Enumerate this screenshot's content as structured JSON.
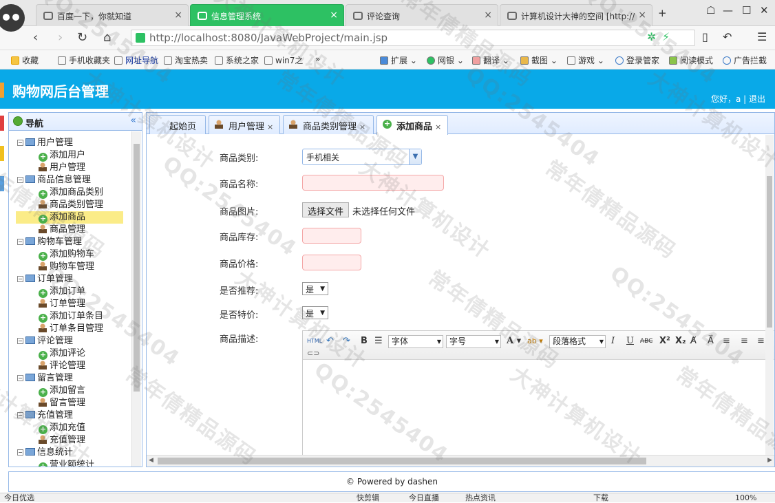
{
  "browser": {
    "tabs": [
      {
        "title": "百度一下，你就知道",
        "active": false
      },
      {
        "title": "信息管理系统",
        "active": true
      },
      {
        "title": "评论查询",
        "active": false
      },
      {
        "title": "计算机设计大神的空间 [http://",
        "active": false
      }
    ],
    "url": "http://localhost:8080/JavaWebProject/main.jsp",
    "bookmarks": [
      "收藏",
      "手机收藏夹",
      "网址导航",
      "淘宝热卖",
      "系统之家",
      "win7之",
      "»"
    ],
    "toolbar_items": [
      "扩展",
      "网银",
      "翻译",
      "截图",
      "游戏",
      "登录管家",
      "阅读模式",
      "广告拦截"
    ],
    "close_symbol": "×"
  },
  "app": {
    "title": "购物网后台管理",
    "greeting": "您好，a | 退出"
  },
  "nav": {
    "header": "导航",
    "collapse_symbol": "«",
    "tree": [
      {
        "label": "用户管理",
        "level": 0
      },
      {
        "label": "添加用户",
        "level": 1,
        "icon": "add"
      },
      {
        "label": "用户管理",
        "level": 1,
        "icon": "user"
      },
      {
        "label": "商品信息管理",
        "level": 0
      },
      {
        "label": "添加商品类别",
        "level": 1,
        "icon": "add"
      },
      {
        "label": "商品类别管理",
        "level": 1,
        "icon": "user"
      },
      {
        "label": "添加商品",
        "level": 1,
        "icon": "add",
        "selected": true
      },
      {
        "label": "商品管理",
        "level": 1,
        "icon": "user"
      },
      {
        "label": "购物车管理",
        "level": 0
      },
      {
        "label": "添加购物车",
        "level": 1,
        "icon": "add"
      },
      {
        "label": "购物车管理",
        "level": 1,
        "icon": "user"
      },
      {
        "label": "订单管理",
        "level": 0
      },
      {
        "label": "添加订单",
        "level": 1,
        "icon": "add"
      },
      {
        "label": "订单管理",
        "level": 1,
        "icon": "user"
      },
      {
        "label": "添加订单条目",
        "level": 1,
        "icon": "add"
      },
      {
        "label": "订单条目管理",
        "level": 1,
        "icon": "user"
      },
      {
        "label": "评论管理",
        "level": 0
      },
      {
        "label": "添加评论",
        "level": 1,
        "icon": "add"
      },
      {
        "label": "评论管理",
        "level": 1,
        "icon": "user"
      },
      {
        "label": "留言管理",
        "level": 0
      },
      {
        "label": "添加留言",
        "level": 1,
        "icon": "add"
      },
      {
        "label": "留言管理",
        "level": 1,
        "icon": "user"
      },
      {
        "label": "充值管理",
        "level": 0
      },
      {
        "label": "添加充值",
        "level": 1,
        "icon": "add"
      },
      {
        "label": "充值管理",
        "level": 1,
        "icon": "user"
      },
      {
        "label": "信息统计",
        "level": 0
      },
      {
        "label": "营业额统计",
        "level": 1,
        "icon": "add"
      }
    ]
  },
  "content_tabs": [
    {
      "label": "起始页",
      "closable": false
    },
    {
      "label": "用户管理",
      "closable": true
    },
    {
      "label": "商品类别管理",
      "closable": true
    },
    {
      "label": "添加商品",
      "closable": true,
      "active": true
    }
  ],
  "form": {
    "category_label": "商品类别:",
    "category_value": "手机相关",
    "name_label": "商品名称:",
    "image_label": "商品图片:",
    "file_button": "选择文件",
    "file_status": "未选择任何文件",
    "stock_label": "商品库存:",
    "price_label": "商品价格:",
    "recommend_label": "是否推荐:",
    "recommend_value": "是",
    "special_label": "是否特价:",
    "special_value": "是",
    "desc_label": "商品描述:"
  },
  "editor_toolbar": {
    "html": "HTML",
    "bold": "B",
    "font_family": "字体",
    "font_size": "字号",
    "paragraph": "段落格式",
    "italic": "I",
    "underline": "U",
    "strike": "ABC",
    "superscript": "X²",
    "subscript": "X₂"
  },
  "footer": "© Powered by dashen",
  "statusbar": {
    "left": "今日优选",
    "items": [
      "快剪辑",
      "今日直播",
      "热点资讯",
      "下载",
      "100%"
    ]
  },
  "watermarks": [
    "QQ:2545404",
    "大神计算机设计",
    "常年倩精品源码"
  ]
}
